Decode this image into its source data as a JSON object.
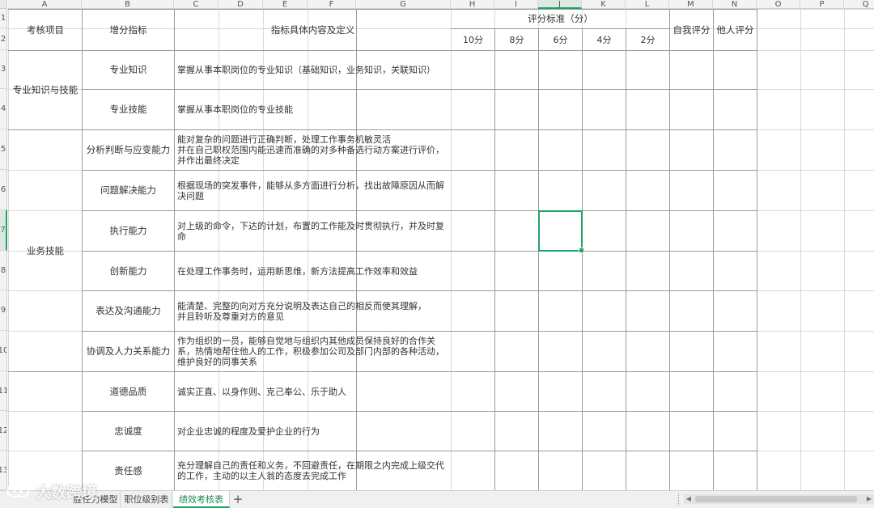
{
  "columns": [
    "A",
    "B",
    "C",
    "D",
    "E",
    "F",
    "G",
    "H",
    "I",
    "J",
    "K",
    "L",
    "M",
    "N",
    "O",
    "P",
    "Q"
  ],
  "rows": [
    "1",
    "2",
    "3",
    "4",
    "5",
    "6",
    "7",
    "8",
    "9",
    "10",
    "11",
    "12",
    "13"
  ],
  "selection": {
    "column": "J",
    "row": "7"
  },
  "header": {
    "category": "考核项目",
    "indicator": "增分指标",
    "definition": "指标具体内容及定义",
    "scoring": "评分标准（分）",
    "scores": [
      "10分",
      "8分",
      "6分",
      "4分",
      "2分"
    ],
    "self_score": "自我评分",
    "peer_score": "他人评分"
  },
  "groups": [
    {
      "name": "专业知识与技能"
    },
    {
      "name": "业务技能"
    },
    {
      "name": ""
    }
  ],
  "items": [
    {
      "indicator": "专业知识",
      "definition": "掌握从事本职岗位的专业知识（基础知识，业务知识，关联知识）"
    },
    {
      "indicator": "专业技能",
      "definition": "掌握从事本职岗位的专业技能"
    },
    {
      "indicator": "分析判断与应变能力",
      "definition": "能对复杂的问题进行正确判断，处理工作事务机敏灵活\n并在自己职权范围内能迅速而准确的对多种备选行动方案进行评价，并作出最终决定"
    },
    {
      "indicator": "问题解决能力",
      "definition": "根据现场的突发事件，能够从多方面进行分析，找出故障原因从而解决问题"
    },
    {
      "indicator": "执行能力",
      "definition": "对上级的命令，下达的计划，布置的工作能及时贯彻执行，并及时复命"
    },
    {
      "indicator": "创新能力",
      "definition": "在处理工作事务时，运用新思维，新方法提高工作效率和效益"
    },
    {
      "indicator": "表达及沟通能力",
      "definition": "能清楚、完整的向对方充分说明及表达自己的相反而使其理解，\n并且聆听及尊重对方的意见"
    },
    {
      "indicator": "协调及人力关系能力",
      "definition": "作为组织的一员，能够自觉地与组织内其他成员保持良好的合作关系，热情地帮住他人的工作，积极参加公司及部门内部的各种活动，维护良好的同事关系"
    },
    {
      "indicator": "道德品质",
      "definition": "诚实正直、以身作则、克己奉公、乐于助人"
    },
    {
      "indicator": "忠诚度",
      "definition": "对企业忠诚的程度及爱护企业的行为"
    },
    {
      "indicator": "责任感",
      "definition": "充分理解自己的责任和义务，不回避责任，在期限之内完成上级交代的工作，主动的以主人翁的态度去完成工作"
    }
  ],
  "tabs": [
    {
      "label": "胜任力模型"
    },
    {
      "label": "职位级别表"
    },
    {
      "label": "绩效考核表",
      "active": true
    }
  ],
  "add_tab_label": "+",
  "watermark": "大数跨境",
  "colors": {
    "accent": "#21a366",
    "active_tab_text": "#1e8a4f",
    "grid": "#d9d9d9",
    "border": "#9a9a9a"
  }
}
